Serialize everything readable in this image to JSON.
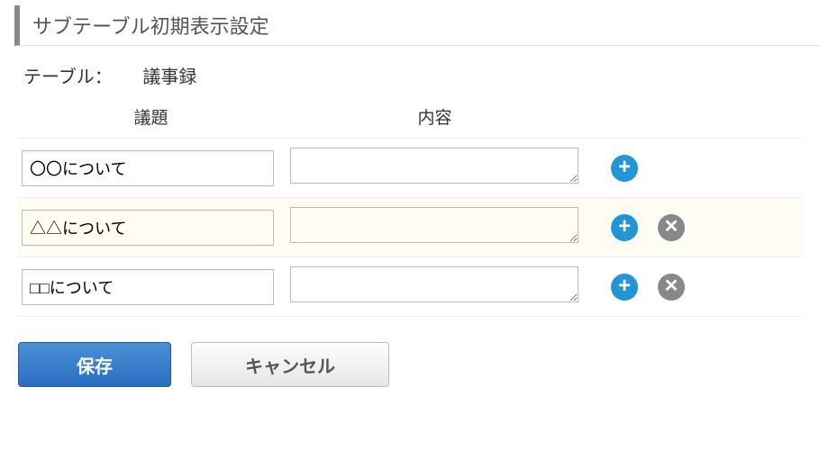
{
  "header": {
    "title": "サブテーブル初期表示設定"
  },
  "table_label": {
    "prefix": "テーブル：",
    "name": "議事録"
  },
  "columns": {
    "col1": "議題",
    "col2": "内容"
  },
  "rows": [
    {
      "agenda": "〇〇について",
      "content": "",
      "highlight": false,
      "deletable": false
    },
    {
      "agenda": "△△について",
      "content": "",
      "highlight": true,
      "deletable": true
    },
    {
      "agenda": "□□について",
      "content": "",
      "highlight": false,
      "deletable": true
    }
  ],
  "buttons": {
    "save": "保存",
    "cancel": "キャンセル"
  },
  "action_icons": {
    "add": "add-icon",
    "delete": "close-icon"
  }
}
